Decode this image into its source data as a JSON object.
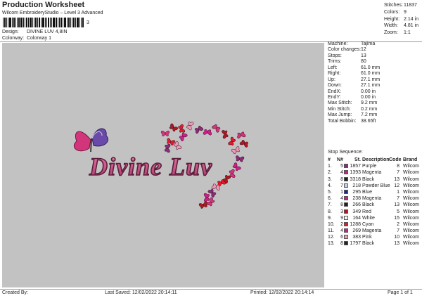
{
  "header": {
    "title": "Production Worksheet",
    "subtitle": "Wilcom EmbroideryStudio – Level 3 Advanced",
    "barcode_num": "3",
    "design_label": "Design:",
    "design_value": "DIVINE LUV 4,8IN",
    "colorway_label": "Colorway:",
    "colorway_value": "Colorway 1"
  },
  "stats": [
    {
      "label": "Stitches:",
      "value": "11837"
    },
    {
      "label": "Colors:",
      "value": "9"
    },
    {
      "label": "Height:",
      "value": "2.14 in"
    },
    {
      "label": "Width:",
      "value": "4.81 in"
    },
    {
      "label": "Zoom:",
      "value": "1:1"
    }
  ],
  "design_text": "Divine Luv",
  "machine_info": [
    {
      "label": "Machine:",
      "value": "Tajima"
    },
    {
      "label": "Color changes:",
      "value": "12"
    },
    {
      "label": "Stops:",
      "value": "13"
    },
    {
      "label": "Trims:",
      "value": "80"
    },
    {
      "label": "Left:",
      "value": "61.0 mm"
    },
    {
      "label": "Right:",
      "value": "61.0 mm"
    },
    {
      "label": "Up:",
      "value": "27.1 mm"
    },
    {
      "label": "Down:",
      "value": "27.1 mm"
    },
    {
      "label": "EndX:",
      "value": "0.00 in"
    },
    {
      "label": "EndY:",
      "value": "0.00 in"
    },
    {
      "label": "Max Stitch:",
      "value": "9.2 mm"
    },
    {
      "label": "Min Stitch:",
      "value": "0.2 mm"
    },
    {
      "label": "Max Jump:",
      "value": "7.2 mm"
    },
    {
      "label": "Total Bobbin:",
      "value": "38.65ft"
    }
  ],
  "stop_sequence_label": "Stop Sequence:",
  "stop_table": {
    "headers": [
      "#",
      "N#",
      "St.",
      "Description",
      "Code",
      "Brand"
    ],
    "rows": [
      {
        "num": "1.",
        "n": "5",
        "color": "#8a2c7a",
        "st": "1857",
        "desc": "Purple",
        "code": "8",
        "brand": "Wilcom"
      },
      {
        "num": "2.",
        "n": "4",
        "color": "#cc1f8a",
        "st": "1393",
        "desc": "Magenta",
        "code": "7",
        "brand": "Wilcom"
      },
      {
        "num": "3.",
        "n": "8",
        "color": "#222222",
        "st": "3318",
        "desc": "Black",
        "code": "13",
        "brand": "Wilcom"
      },
      {
        "num": "4.",
        "n": "7",
        "color": "#c8d0e6",
        "st": "218",
        "desc": "Powder Blue",
        "code": "12",
        "brand": "Wilcom"
      },
      {
        "num": "5.",
        "n": "1",
        "color": "#1c2a9c",
        "st": "295",
        "desc": "Blue",
        "code": "1",
        "brand": "Wilcom"
      },
      {
        "num": "6.",
        "n": "4",
        "color": "#cc1f8a",
        "st": "238",
        "desc": "Magenta",
        "code": "7",
        "brand": "Wilcom"
      },
      {
        "num": "7.",
        "n": "8",
        "color": "#222222",
        "st": "266",
        "desc": "Black",
        "code": "13",
        "brand": "Wilcom"
      },
      {
        "num": "8.",
        "n": "3",
        "color": "#b0171f",
        "st": "349",
        "desc": "Red",
        "code": "5",
        "brand": "Wilcom"
      },
      {
        "num": "9.",
        "n": "9",
        "color": "#f8f8f8",
        "st": "164",
        "desc": "White",
        "code": "15",
        "brand": "Wilcom"
      },
      {
        "num": "10.",
        "n": "2",
        "color": "#e21a2c",
        "st": "1288",
        "desc": "Cyan",
        "code": "2",
        "brand": "Wilcom"
      },
      {
        "num": "11.",
        "n": "4",
        "color": "#cc1f8a",
        "st": "269",
        "desc": "Magenta",
        "code": "7",
        "brand": "Wilcom"
      },
      {
        "num": "12.",
        "n": "6",
        "color": "#ee9ab6",
        "st": "383",
        "desc": "Pink",
        "code": "10",
        "brand": "Wilcom"
      },
      {
        "num": "13.",
        "n": "8",
        "color": "#222222",
        "st": "1797",
        "desc": "Black",
        "code": "13",
        "brand": "Wilcom"
      }
    ]
  },
  "footer": {
    "created": "Created By:",
    "saved": "Last Saved: 12/02/2022 20:14:11",
    "printed": "Printed: 12/02/2022 20:14:14",
    "page": "Page 1 of 1"
  },
  "colors": {
    "canvas": "#c2c2c2",
    "text_fill": "#c8407c",
    "text_outline": "#5a1f3a"
  }
}
